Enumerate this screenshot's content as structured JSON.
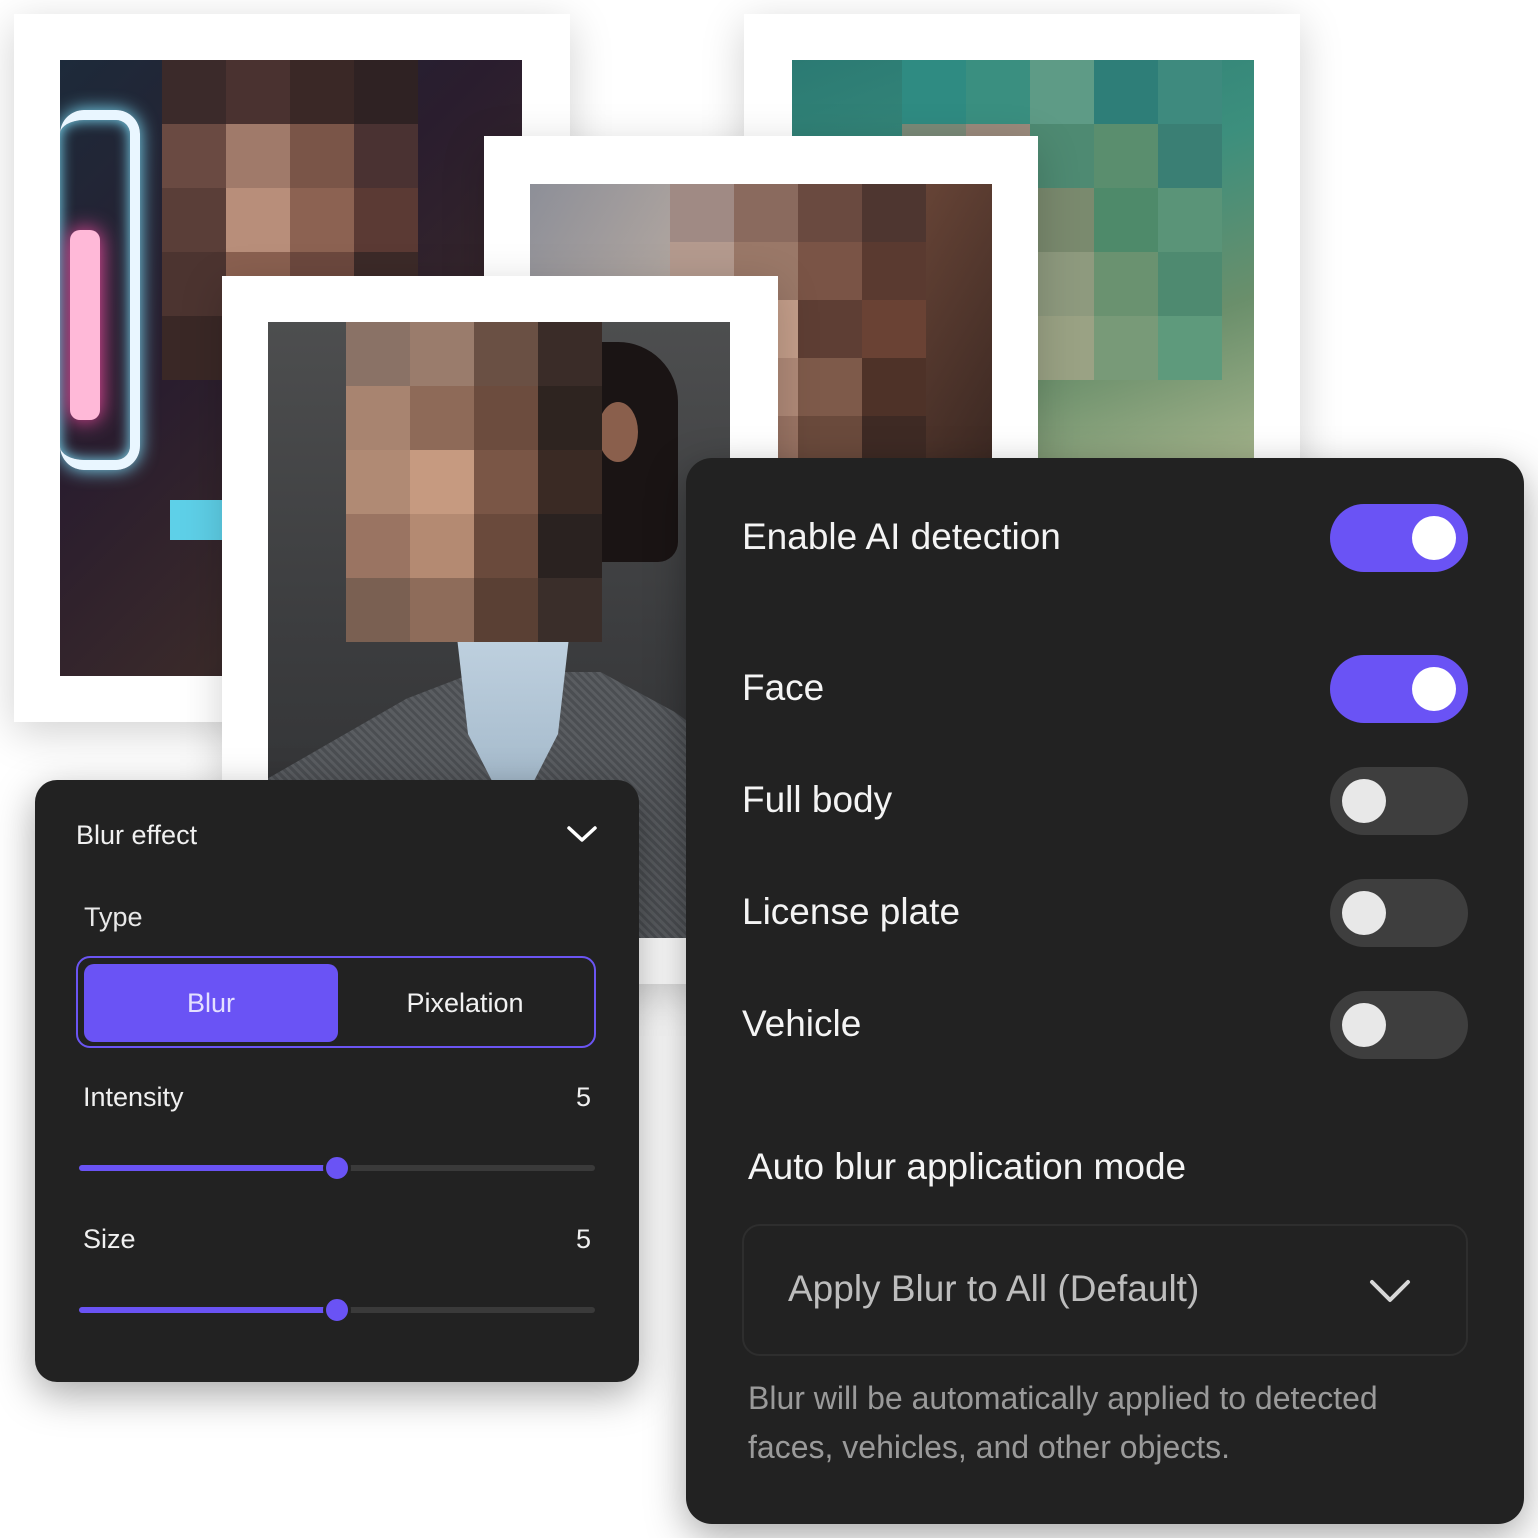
{
  "blur_panel": {
    "title": "Blur effect",
    "type_label": "Type",
    "type_options": [
      "Blur",
      "Pixelation"
    ],
    "selected_type": "Blur",
    "intensity": {
      "label": "Intensity",
      "value": "5",
      "fraction": 0.5
    },
    "size": {
      "label": "Size",
      "value": "5",
      "fraction": 0.5
    }
  },
  "detection_panel": {
    "items": [
      {
        "label": "Enable AI detection",
        "on": true
      },
      {
        "label": "Face",
        "on": true
      },
      {
        "label": "Full body",
        "on": false
      },
      {
        "label": "License plate",
        "on": false
      },
      {
        "label": "Vehicle",
        "on": false
      }
    ],
    "mode_title": "Auto blur application mode",
    "mode_value": "Apply Blur to All (Default)",
    "description": "Blur will be automatically applied to detected faces, vehicles, and other objects."
  },
  "colors": {
    "accent": "#6a53f5",
    "panel_bg": "#222222"
  },
  "icons": {
    "dropdown": "chevron-down-icon"
  }
}
